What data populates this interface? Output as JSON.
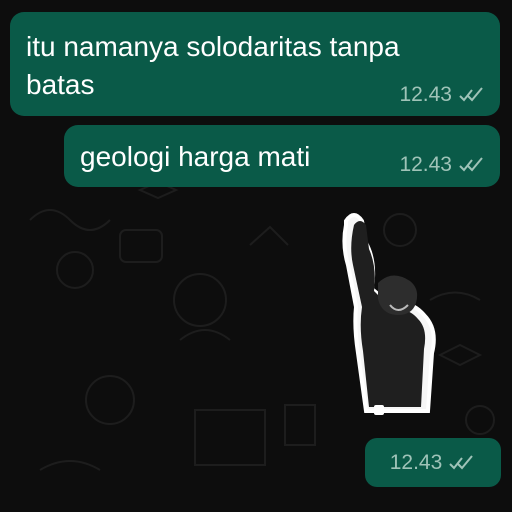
{
  "messages": [
    {
      "text_line1": "itu namanya solodaritas tanpa",
      "text_line2": "batas",
      "time": "12.43"
    },
    {
      "text": "geologi harga mati",
      "time": "12.43"
    }
  ],
  "sticker_message": {
    "time": "12.43"
  },
  "icons": {
    "read_status": "double-check-icon",
    "sticker": "raised-fist-sticker-icon"
  },
  "colors": {
    "bubble": "#0a5a48",
    "timestamp": "#9fc3b8",
    "text": "#ffffff"
  }
}
